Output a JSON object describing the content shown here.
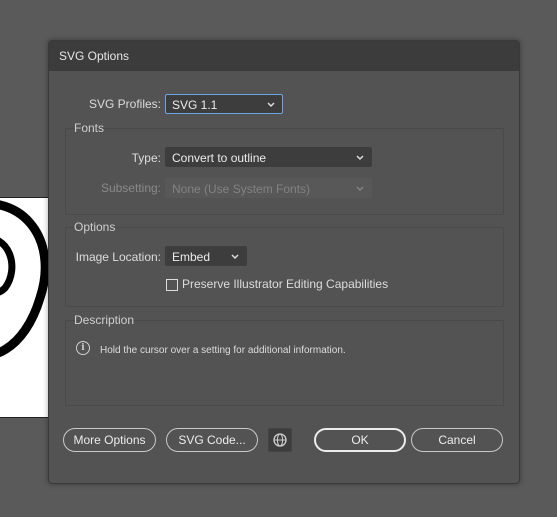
{
  "dialog": {
    "title": "SVG Options"
  },
  "profiles": {
    "label": "SVG Profiles:",
    "value": "SVG 1.1"
  },
  "fonts": {
    "group_title": "Fonts",
    "type_label": "Type:",
    "type_value": "Convert to outline",
    "subsetting_label": "Subsetting:",
    "subsetting_value": "None (Use System Fonts)"
  },
  "options": {
    "group_title": "Options",
    "image_location_label": "Image Location:",
    "image_location_value": "Embed",
    "preserve_label": "Preserve Illustrator Editing Capabilities",
    "preserve_checked": false
  },
  "description": {
    "group_title": "Description",
    "info_glyph": "i",
    "text": "Hold the cursor over a setting for additional information."
  },
  "buttons": {
    "more_options": "More Options",
    "svg_code": "SVG Code...",
    "ok": "OK",
    "cancel": "Cancel"
  },
  "icons": {
    "chevron": "chevron-down-icon",
    "globe": "globe-icon",
    "info": "info-icon"
  },
  "colors": {
    "dialog_bg": "#535353",
    "titlebar_bg": "#3c3c3c",
    "focus_border": "#6aa3e6"
  }
}
